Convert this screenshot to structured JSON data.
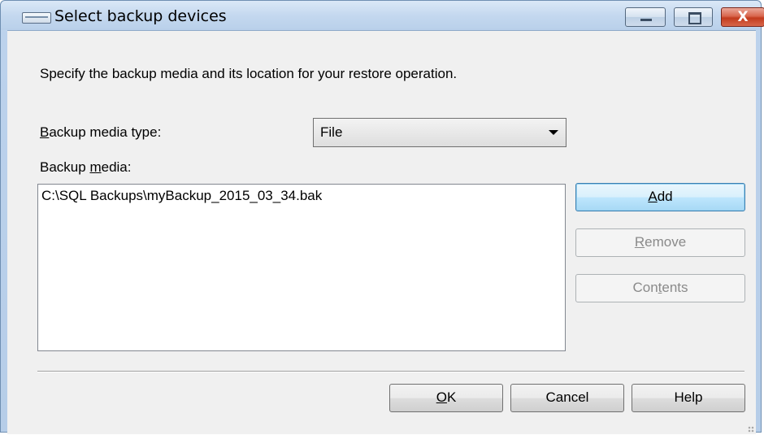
{
  "window": {
    "title": "Select backup devices",
    "close_glyph": "X"
  },
  "description": "Specify the backup media and its location for your restore operation.",
  "media_type": {
    "label_accel": "B",
    "label_rest": "ackup media type:",
    "selected": "File"
  },
  "media": {
    "label_pre": "Backup ",
    "label_accel": "m",
    "label_rest": "edia:",
    "items": [
      "C:\\SQL Backups\\myBackup_2015_03_34.bak"
    ]
  },
  "buttons": {
    "add": {
      "accel": "A",
      "rest": "dd"
    },
    "remove": {
      "accel": "R",
      "rest": "emove"
    },
    "contents": {
      "pre": "Con",
      "accel": "t",
      "rest": "ents"
    },
    "ok": {
      "accel": "O",
      "rest": "K"
    },
    "cancel": "Cancel",
    "help": "Help"
  },
  "icons": {
    "app": "window-icon",
    "minimize": "minimize-icon",
    "maximize": "maximize-icon",
    "close": "close-icon",
    "dropdown": "chevron-down-icon"
  },
  "colors": {
    "dialog_bg": "#f0f0f0",
    "title_bar": "#c4d8ef",
    "close_button": "#c23b1d",
    "default_button_border": "#3c7fb1"
  }
}
